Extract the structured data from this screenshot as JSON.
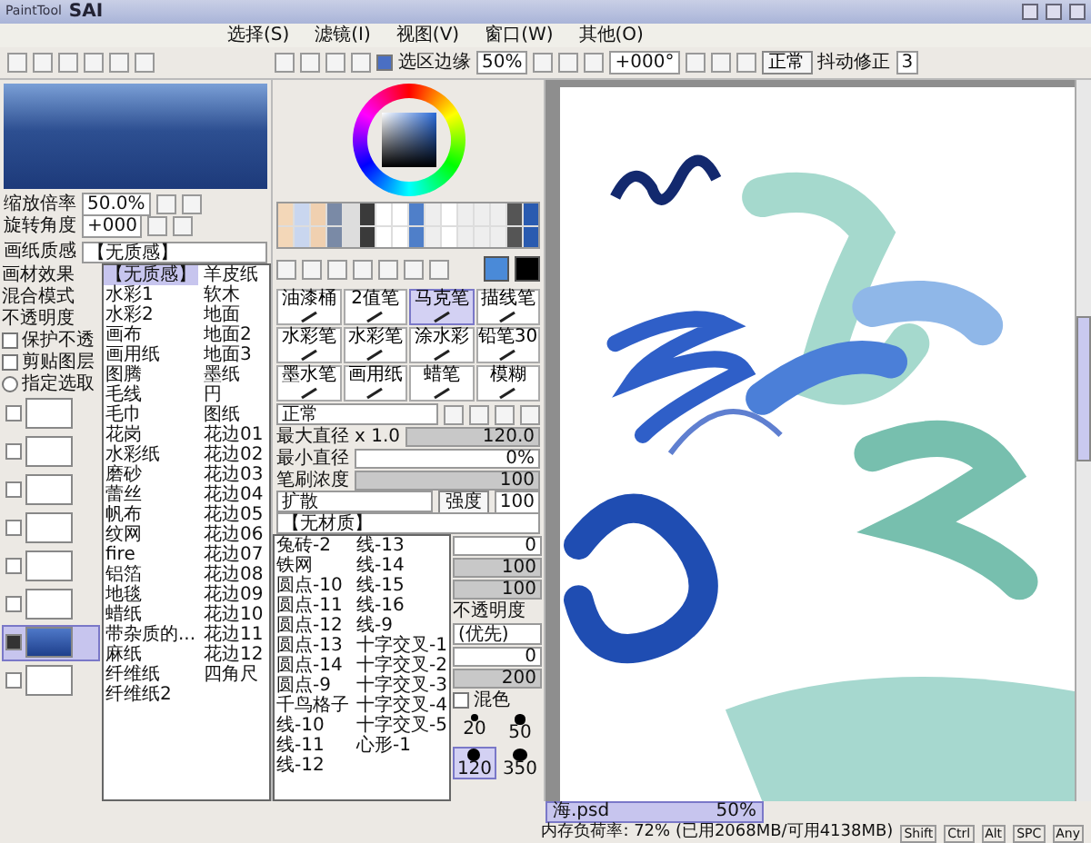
{
  "window": {
    "brand": "PaintTool",
    "logo": "SAI"
  },
  "menu": [
    {
      "label": "选择(S)"
    },
    {
      "label": "滤镜(I)"
    },
    {
      "label": "视图(V)"
    },
    {
      "label": "窗口(W)"
    },
    {
      "label": "其他(O)"
    }
  ],
  "toolbar": {
    "selection_edge": {
      "label": "选区边缘",
      "checked": true
    },
    "zoom": "50%",
    "angle": "+000°",
    "mode_button": "正常",
    "stabilizer_label": "抖动修正",
    "stabilizer": "3"
  },
  "navigator": {
    "zoom_label": "缩放倍率",
    "zoom": "50.0%",
    "angle_label": "旋转角度",
    "angle": "+000"
  },
  "layer_panel": {
    "paper_texture_label": "画纸质感",
    "paper_texture": "【无质感】",
    "labels": [
      "画材效果",
      "混合模式",
      "不透明度"
    ],
    "options": [
      {
        "kind": "checkbox",
        "label": "保护不透",
        "checked": false
      },
      {
        "kind": "checkbox",
        "label": "剪贴图层",
        "checked": false
      },
      {
        "kind": "radio",
        "label": "指定选取",
        "checked": false
      }
    ],
    "layers": [
      {
        "selected": false,
        "visible": false
      },
      {
        "selected": false,
        "visible": false
      },
      {
        "selected": false,
        "visible": false
      },
      {
        "selected": false,
        "visible": false
      },
      {
        "selected": false,
        "visible": false
      },
      {
        "selected": false,
        "visible": false
      },
      {
        "selected": true,
        "visible": true
      },
      {
        "selected": false,
        "visible": false
      }
    ],
    "texture_list": [
      {
        "label": "【无质感】",
        "selected": true
      },
      {
        "label": "水彩1",
        "selected": false
      },
      {
        "label": "水彩2",
        "selected": false
      },
      {
        "label": "画布",
        "selected": false
      },
      {
        "label": "画用纸",
        "selected": false
      },
      {
        "label": "图腾",
        "selected": false
      },
      {
        "label": "毛线",
        "selected": false
      },
      {
        "label": "毛巾",
        "selected": false
      },
      {
        "label": "花岗",
        "selected": false
      },
      {
        "label": "水彩纸",
        "selected": false
      },
      {
        "label": "磨砂",
        "selected": false
      },
      {
        "label": "蕾丝",
        "selected": false
      },
      {
        "label": "帆布",
        "selected": false
      },
      {
        "label": "纹网",
        "selected": false
      },
      {
        "label": "fire",
        "selected": false
      },
      {
        "label": "铝箔",
        "selected": false
      },
      {
        "label": "地毯",
        "selected": false
      },
      {
        "label": "蜡纸",
        "selected": false
      },
      {
        "label": "带杂质的...",
        "selected": false
      },
      {
        "label": "麻纸",
        "selected": false
      },
      {
        "label": "纤维纸",
        "selected": false
      },
      {
        "label": "纤维纸2",
        "selected": false
      },
      {
        "label": "羊皮纸",
        "selected": false
      },
      {
        "label": "软木",
        "selected": false
      },
      {
        "label": "地面",
        "selected": false
      },
      {
        "label": "地面2",
        "selected": false
      },
      {
        "label": "地面3",
        "selected": false
      },
      {
        "label": "墨纸",
        "selected": false
      },
      {
        "label": "円",
        "selected": false
      },
      {
        "label": "图纸",
        "selected": false
      },
      {
        "label": "花边01",
        "selected": false
      },
      {
        "label": "花边02",
        "selected": false
      },
      {
        "label": "花边03",
        "selected": false
      },
      {
        "label": "花边04",
        "selected": false
      },
      {
        "label": "花边05",
        "selected": false
      },
      {
        "label": "花边06",
        "selected": false
      },
      {
        "label": "花边07",
        "selected": false
      },
      {
        "label": "花边08",
        "selected": false
      },
      {
        "label": "花边09",
        "selected": false
      },
      {
        "label": "花边10",
        "selected": false
      },
      {
        "label": "花边11",
        "selected": false
      },
      {
        "label": "花边12",
        "selected": false
      },
      {
        "label": "四角尺",
        "selected": false
      }
    ]
  },
  "brush_tools": [
    {
      "label": "油漆桶",
      "selected": false
    },
    {
      "label": "2值笔",
      "selected": false
    },
    {
      "label": "马克笔",
      "selected": true
    },
    {
      "label": "描线笔",
      "selected": false
    },
    {
      "label": "水彩笔",
      "selected": false
    },
    {
      "label": "水彩笔",
      "selected": false
    },
    {
      "label": "涂水彩",
      "selected": false
    },
    {
      "label": "铅笔30",
      "selected": false
    },
    {
      "label": "墨水笔",
      "selected": false
    },
    {
      "label": "画用纸",
      "selected": false
    },
    {
      "label": "蜡笔",
      "selected": false
    },
    {
      "label": "模糊",
      "selected": false
    }
  ],
  "brush_settings": {
    "mode": "正常",
    "max_size_label": "最大直径",
    "max_size_mult": "x 1.0",
    "max_size": {
      "text": "120.0",
      "level": 1
    },
    "min_size_label": "最小直径",
    "min_size": {
      "text": "0%",
      "level": 0
    },
    "density_label": "笔刷浓度",
    "density": {
      "text": "100",
      "level": 1
    },
    "blend": "扩散",
    "strength_label": "强度",
    "strength": "100",
    "texture": "【无材质】",
    "texture_list": [
      {
        "label": "兔砖-2",
        "selected": false
      },
      {
        "label": "铁网",
        "selected": false
      },
      {
        "label": "圆点-10",
        "selected": false
      },
      {
        "label": "圆点-11",
        "selected": false
      },
      {
        "label": "圆点-12",
        "selected": false
      },
      {
        "label": "圆点-13",
        "selected": false
      },
      {
        "label": "圆点-14",
        "selected": false
      },
      {
        "label": "圆点-9",
        "selected": false
      },
      {
        "label": "千鸟格子",
        "selected": false
      },
      {
        "label": "线-10",
        "selected": false
      },
      {
        "label": "线-11",
        "selected": false
      },
      {
        "label": "线-12",
        "selected": false
      },
      {
        "label": "线-13",
        "selected": false
      },
      {
        "label": "线-14",
        "selected": false
      },
      {
        "label": "线-15",
        "selected": false
      },
      {
        "label": "线-16",
        "selected": false
      },
      {
        "label": "线-9",
        "selected": false
      },
      {
        "label": "十字交叉-1",
        "selected": false
      },
      {
        "label": "十字交叉-2",
        "selected": false
      },
      {
        "label": "十字交叉-3",
        "selected": false
      },
      {
        "label": "十字交叉-4",
        "selected": false
      },
      {
        "label": "十字交叉-5",
        "selected": false
      },
      {
        "label": "心形-1",
        "selected": false
      }
    ],
    "values_top": [
      {
        "text": "0",
        "level": 0
      },
      {
        "text": "100",
        "level": 1
      },
      {
        "text": "100",
        "level": 1
      }
    ],
    "opacity_label": "不透明度",
    "priority": "(优先)",
    "values_bottom": [
      {
        "text": "0",
        "level": 0
      },
      {
        "text": "200",
        "level": 1
      }
    ],
    "mix": {
      "label": "混色",
      "checked": false
    },
    "sizes": [
      {
        "label": "20",
        "selected": false
      },
      {
        "label": "50",
        "selected": false
      },
      {
        "label": "120",
        "selected": true
      },
      {
        "label": "350",
        "selected": false
      }
    ]
  },
  "document_tabs": [
    {
      "name": "海.psd",
      "zoom": "50%",
      "selected": true
    }
  ],
  "status_bar": {
    "memory": "内存负荷率: 72% (已用2068MB/可用4138MB)",
    "keys": [
      "Shift",
      "Ctrl",
      "Alt",
      "SPC",
      "Any"
    ]
  }
}
